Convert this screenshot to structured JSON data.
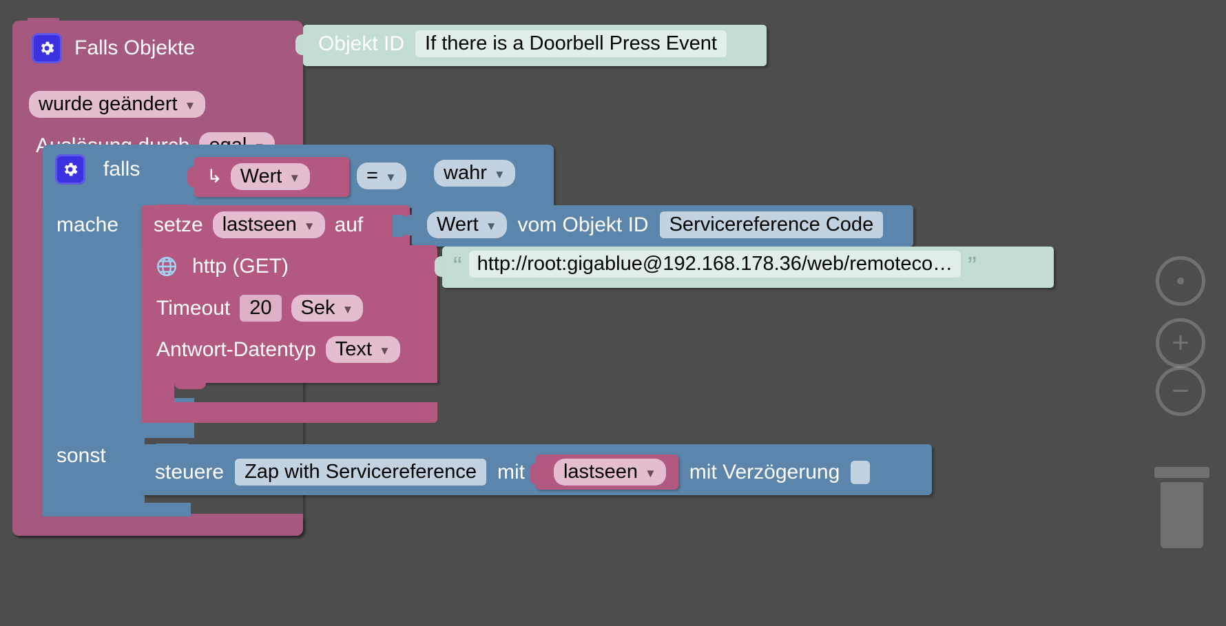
{
  "workspace": {
    "background_color": "#4d4d4d",
    "controls": {
      "zoom_reset": "zoom-reset-icon",
      "zoom_in_label": "+",
      "zoom_out_label": "−",
      "trash_label": "trash-icon"
    }
  },
  "hat_block": {
    "color": "#a5597e",
    "icon": "gear-icon",
    "title": "Falls Objekte",
    "mode_dropdown": "wurde geändert",
    "trigger_label": "Auslösung durch",
    "trigger_dropdown": "egal",
    "object_input": {
      "color": "#c3ddd4",
      "label": "Objekt ID",
      "value": "If there is a Doorbell Press Event"
    }
  },
  "control_block": {
    "color": "#5c85ab",
    "icon": "gear-icon",
    "if_label": "falls",
    "do_label": "mache",
    "else_label": "sonst",
    "condition": {
      "color": "#b3597f",
      "arrow_icon": "arrow-right-hook-icon",
      "left_dropdown": "Wert",
      "operator_dropdown": "=",
      "right_dropdown": "wahr"
    }
  },
  "set_block": {
    "color": "#b3597f",
    "prefix_label": "setze",
    "variable_dropdown": "lastseen",
    "suffix_label": "auf"
  },
  "get_value_block": {
    "color": "#5c85ab",
    "value_dropdown": "Wert",
    "from_label": "vom Objekt ID",
    "object_id": "Servicereference Code"
  },
  "http_block": {
    "color": "#b3597f",
    "icon": "globe-icon",
    "title": "http (GET)",
    "timeout_label": "Timeout",
    "timeout_value": "20",
    "timeout_unit": "Sek",
    "response_type_label": "Antwort-Datentyp",
    "response_type_value": "Text",
    "url_input": {
      "color": "#c3ddd4",
      "quote_icon": "quote-icon",
      "value": "http://root:gigablue@192.168.178.36/web/remoteco…"
    }
  },
  "control_call_block": {
    "color": "#5c85ab",
    "prefix_label": "steuere",
    "target": "Zap with Servicereference",
    "with_label": "mit",
    "argument_dropdown": "lastseen",
    "delay_label": "mit Verzögerung",
    "delay_value": ""
  }
}
